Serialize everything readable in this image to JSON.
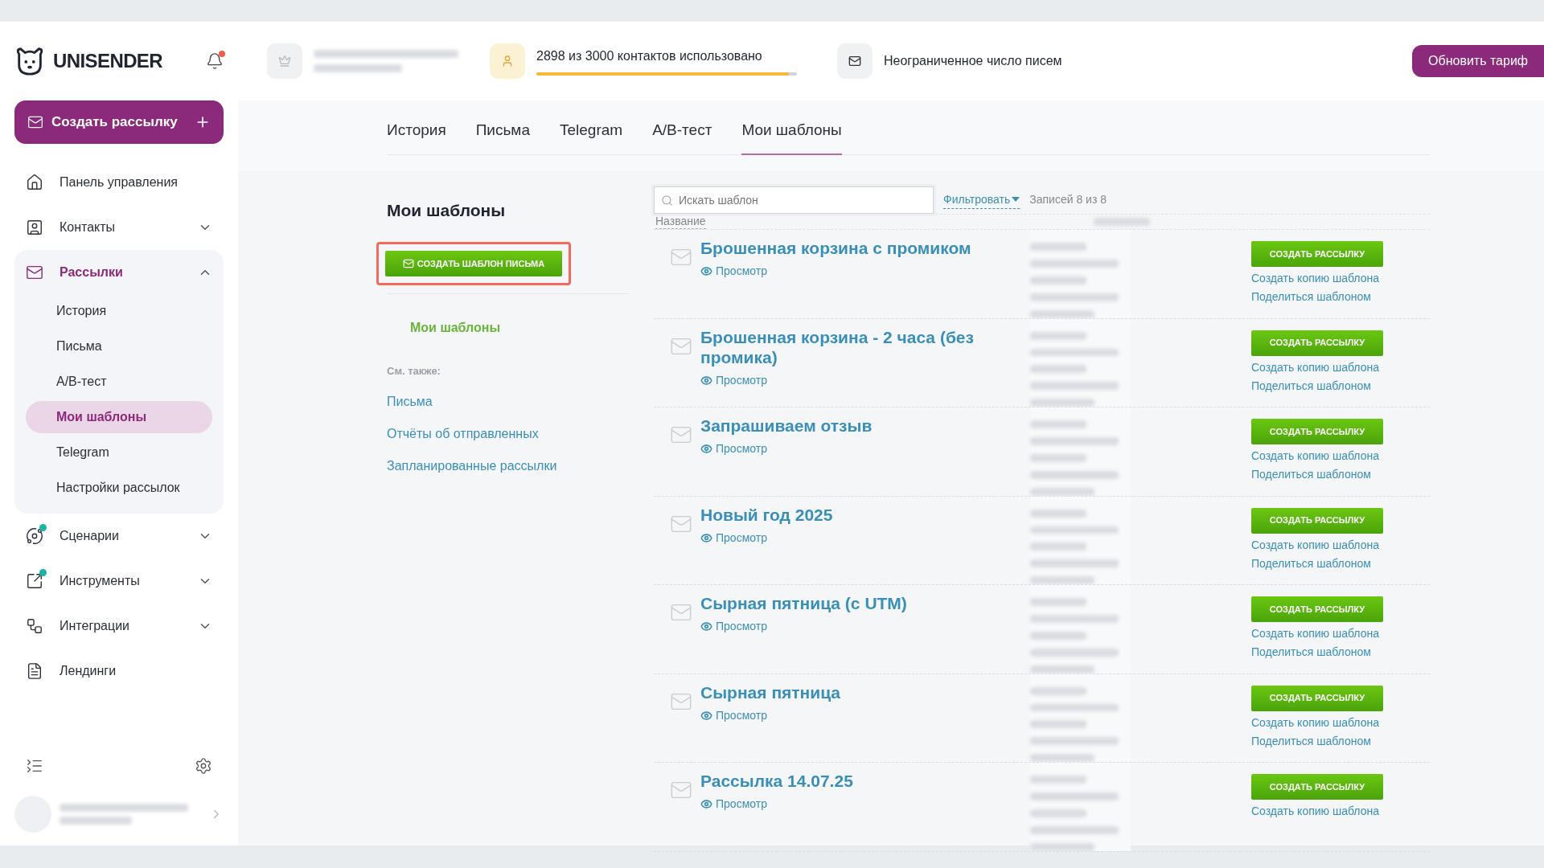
{
  "header": {
    "logo": "UNISENDER",
    "notifications_unread": true,
    "contacts": {
      "text": "2898 из 3000 контактов использовано",
      "level": 0.97
    },
    "letters": {
      "text": "Неограниченное число писем"
    },
    "upgrade_button": "Обновить тариф"
  },
  "sidebar": {
    "create_button": "Создать рассылку",
    "items": [
      {
        "label": "Панель управления",
        "kind": "link",
        "badge": false,
        "selected": false
      },
      {
        "label": "Контакты",
        "kind": "group",
        "badge": false,
        "expanded": false,
        "selected": false
      },
      {
        "label": "Рассылки",
        "kind": "group",
        "badge": false,
        "expanded": true,
        "selected": true,
        "children": [
          {
            "label": "История",
            "selected": false
          },
          {
            "label": "Письма",
            "selected": false
          },
          {
            "label": "A/B-тест",
            "selected": false
          },
          {
            "label": "Мои шаблоны",
            "selected": true
          },
          {
            "label": "Telegram",
            "selected": false
          },
          {
            "label": "Настройки рассылок",
            "selected": false
          }
        ]
      },
      {
        "label": "Сценарии",
        "kind": "group",
        "badge": true,
        "expanded": false,
        "selected": false
      },
      {
        "label": "Инструменты",
        "kind": "group",
        "badge": true,
        "expanded": false,
        "selected": false
      },
      {
        "label": "Интеграции",
        "kind": "group",
        "badge": false,
        "expanded": false,
        "selected": false
      },
      {
        "label": "Лендинги",
        "kind": "link",
        "badge": false,
        "selected": false
      }
    ]
  },
  "tabs": [
    {
      "label": "История",
      "selected": false
    },
    {
      "label": "Письма",
      "selected": false
    },
    {
      "label": "Telegram",
      "selected": false
    },
    {
      "label": "A/B-тест",
      "selected": false
    },
    {
      "label": "Мои шаблоны",
      "selected": true
    }
  ],
  "page": {
    "title": "Мои шаблоны",
    "create_template_button": "СОЗДАТЬ ШАБЛОН ПИСЬМА",
    "current_section": "Мои шаблоны",
    "see_also": "См. также:",
    "links": [
      "Письма",
      "Отчёты об отправленных",
      "Запланированные рассылки"
    ]
  },
  "templates": {
    "search": {
      "placeholder": "Искать шаблон"
    },
    "filter": "Фильтровать",
    "count": "Записей 8 из 8",
    "columns": [
      "Название"
    ],
    "rows": [
      {
        "name": "Брошенная корзина с промиком",
        "preview": "Просмотр",
        "button": "СОЗДАТЬ РАССЫЛКУ",
        "copy": "Создать копию шаблона",
        "share": "Поделиться шаблоном"
      },
      {
        "name": "Брошенная корзина - 2 часа (без промика)",
        "preview": "Просмотр",
        "button": "СОЗДАТЬ РАССЫЛКУ",
        "copy": "Создать копию шаблона",
        "share": "Поделиться шаблоном"
      },
      {
        "name": "Запрашиваем отзыв",
        "preview": "Просмотр",
        "button": "СОЗДАТЬ РАССЫЛКУ",
        "copy": "Создать копию шаблона",
        "share": "Поделиться шаблоном"
      },
      {
        "name": "Новый год 2025",
        "preview": "Просмотр",
        "button": "СОЗДАТЬ РАССЫЛКУ",
        "copy": "Создать копию шаблона",
        "share": "Поделиться шаблоном"
      },
      {
        "name": "Сырная пятница (с UTM)",
        "preview": "Просмотр",
        "button": "СОЗДАТЬ РАССЫЛКУ",
        "copy": "Создать копию шаблона",
        "share": "Поделиться шаблоном"
      },
      {
        "name": "Сырная пятница",
        "preview": "Просмотр",
        "button": "СОЗДАТЬ РАССЫЛКУ",
        "copy": "Создать копию шаблона",
        "share": "Поделиться шаблоном"
      },
      {
        "name": "Рассылка 14.07.25",
        "preview": "Просмотр",
        "button": "СОЗДАТЬ РАССЫЛКУ",
        "copy": "Создать копию шаблона"
      }
    ]
  }
}
